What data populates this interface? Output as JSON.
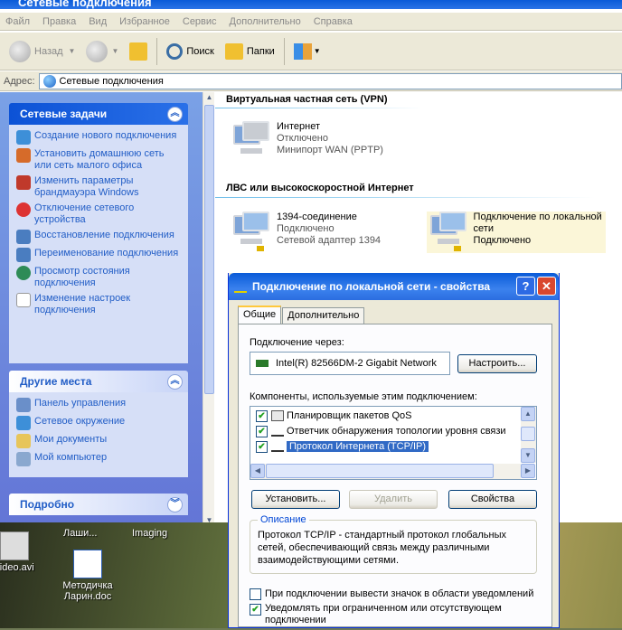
{
  "window": {
    "title": "Сетевые подключения"
  },
  "menu": [
    "Файл",
    "Правка",
    "Вид",
    "Избранное",
    "Сервис",
    "Дополнительно",
    "Справка"
  ],
  "toolbar": {
    "back": "Назад",
    "search": "Поиск",
    "folders": "Папки"
  },
  "address": {
    "label": "Адрес:",
    "value": "Сетевые подключения"
  },
  "tasks": {
    "network": {
      "title": "Сетевые задачи",
      "items": [
        {
          "label": "Создание нового подключения",
          "icon": "new-connection-icon"
        },
        {
          "label": "Установить домашнюю сеть или сеть малого офиса",
          "icon": "home-network-icon"
        },
        {
          "label": "Изменить параметры брандмауэра Windows",
          "icon": "firewall-icon"
        },
        {
          "label": "Отключение сетевого устройства",
          "icon": "disable-icon"
        },
        {
          "label": "Восстановление подключения",
          "icon": "repair-icon"
        },
        {
          "label": "Переименование подключения",
          "icon": "rename-icon"
        },
        {
          "label": "Просмотр состояния подключения",
          "icon": "status-icon"
        },
        {
          "label": "Изменение настроек подключения",
          "icon": "settings-icon"
        }
      ]
    },
    "places": {
      "title": "Другие места",
      "items": [
        {
          "label": "Панель управления",
          "icon": "control-panel-icon"
        },
        {
          "label": "Сетевое окружение",
          "icon": "network-places-icon"
        },
        {
          "label": "Мои документы",
          "icon": "my-documents-icon"
        },
        {
          "label": "Мой компьютер",
          "icon": "my-computer-icon"
        }
      ]
    },
    "details": {
      "title": "Подробно"
    }
  },
  "content": {
    "vpn_group": "Виртуальная частная сеть (VPN)",
    "vpn": {
      "name": "Интернет",
      "status": "Отключено",
      "device": "Минипорт WAN (PPTP)"
    },
    "lan_group": "ЛВС или высокоскоростной Интернет",
    "lan1": {
      "name": "1394-соединение",
      "status": "Подключено",
      "device": "Сетевой адаптер 1394"
    },
    "lan2": {
      "name": "Подключение по локальной сети",
      "status": "Подключено"
    }
  },
  "dialog": {
    "title": "Подключение по локальной сети - свойства",
    "help": "?",
    "close": "✕",
    "tabs": [
      "Общие",
      "Дополнительно"
    ],
    "connect_via_label": "Подключение через:",
    "adapter": "Intel(R) 82566DM-2 Gigabit Network",
    "configure": "Настроить...",
    "components_label": "Компоненты, используемые этим подключением:",
    "components": [
      {
        "label": "Планировщик пакетов QoS",
        "checked": true
      },
      {
        "label": "Ответчик обнаружения топологии уровня связи",
        "checked": true
      },
      {
        "label": "Протокол Интернета (TCP/IP)",
        "checked": true
      }
    ],
    "install": "Установить...",
    "remove": "Удалить",
    "properties": "Свойства",
    "description_title": "Описание",
    "description": "Протокол TCP/IP - стандартный протокол глобальных сетей, обеспечивающий связь между различными взаимодействующими сетями.",
    "show_icon": "При подключении вывести значок в области уведомлений",
    "notify": "Уведомлять при ограниченном или отсутствующем подключении"
  },
  "desktop": {
    "icons": [
      {
        "label": "video.avi"
      },
      {
        "label": "Методичка Ларин.doc"
      }
    ],
    "partial": [
      "Лаши...",
      "Imaging"
    ]
  }
}
